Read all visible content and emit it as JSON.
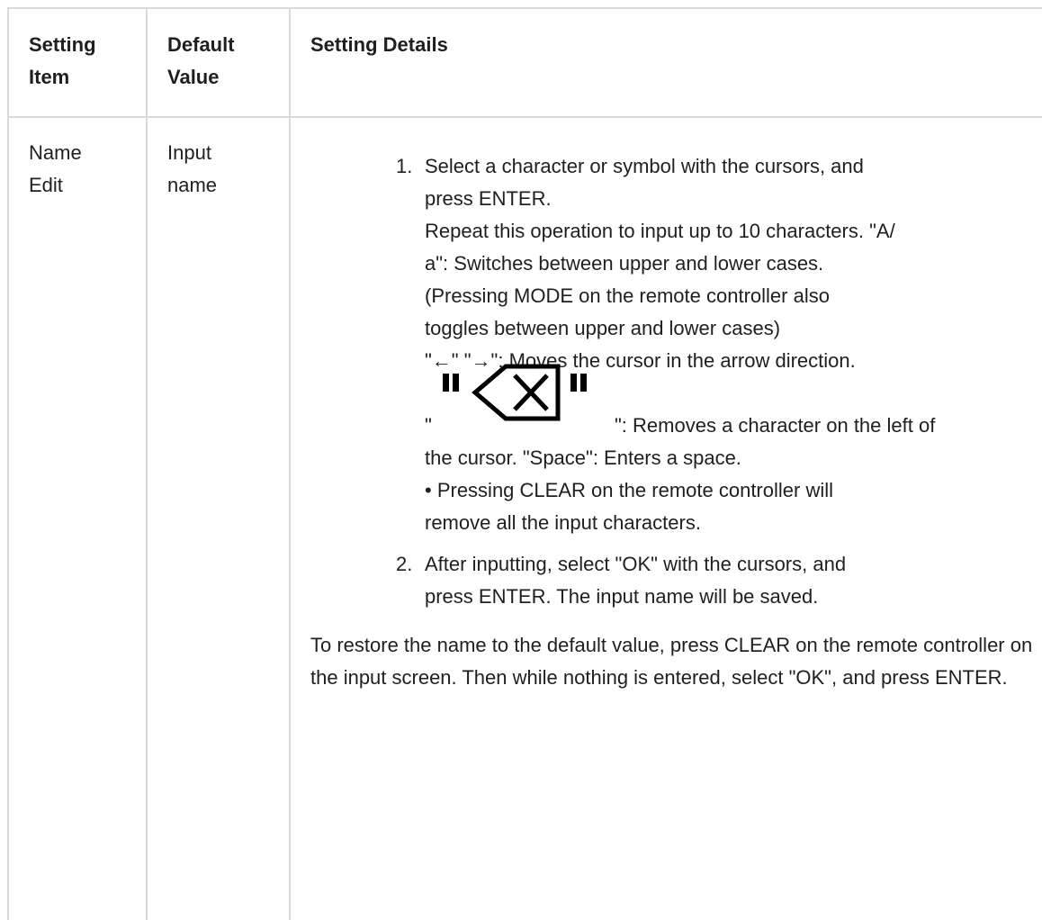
{
  "table": {
    "headers": {
      "item": "Setting Item",
      "default": "Default Value",
      "details": "Setting Details"
    },
    "row": {
      "item": "Name Edit",
      "default": "Input name",
      "steps": [
        {
          "number": "1.",
          "line1": "Select a character or symbol with the cursors, and",
          "line2": "press ENTER.",
          "line3": "Repeat this operation to input up to 10 characters. \"A/",
          "line4": "a\": Switches between upper and lower cases.",
          "line5": "(Pressing MODE on the remote controller also",
          "line6": "toggles between upper and lower cases)",
          "arrows_line": "\"←\" \"→\": Moves the cursor in the arrow direction.",
          "backspace_open": "\"",
          "backspace_close": "\": Removes a character on the left of",
          "line9": "the cursor. \"Space\": Enters a space.",
          "line10": "• Pressing CLEAR on the remote controller will",
          "line11": "remove all the input characters."
        },
        {
          "number": "2.",
          "line1": "After inputting, select \"OK\" with the cursors, and",
          "line2": "press ENTER. The input name will be saved."
        }
      ],
      "restore_note": "To restore the name to the default value, press CLEAR on the remote controller on the input screen. Then while nothing is entered, select \"OK\", and press ENTER."
    }
  },
  "icons": {
    "backspace": "backspace-icon"
  }
}
